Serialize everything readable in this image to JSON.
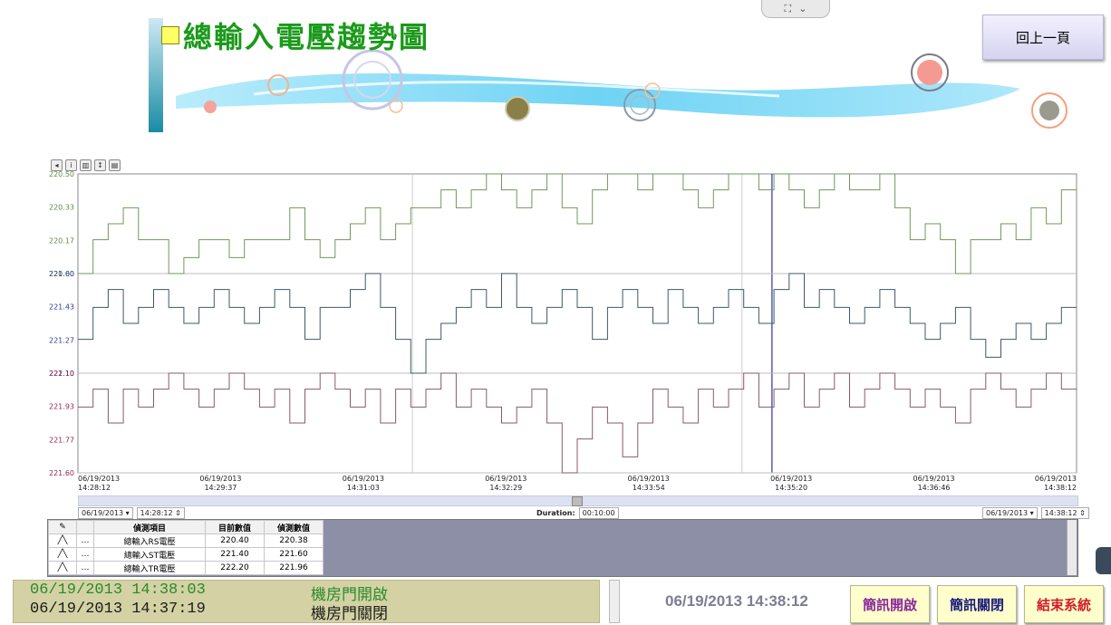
{
  "header": {
    "title": "總輸入電壓趨勢圖",
    "back_button": "回上一頁"
  },
  "chart_data": {
    "type": "line",
    "x_start": "06/19/2013 14:28:12",
    "x_end": "06/19/2013 14:38:12",
    "x_tick_labels": [
      {
        "date": "06/19/2013",
        "time": "14:28:12"
      },
      {
        "date": "06/19/2013",
        "time": "14:29:37"
      },
      {
        "date": "06/19/2013",
        "time": "14:31:03"
      },
      {
        "date": "06/19/2013",
        "time": "14:32:29"
      },
      {
        "date": "06/19/2013",
        "time": "14:33:54"
      },
      {
        "date": "06/19/2013",
        "time": "14:35:20"
      },
      {
        "date": "06/19/2013",
        "time": "14:36:46"
      },
      {
        "date": "06/19/2013",
        "time": "14:38:12"
      }
    ],
    "series": [
      {
        "color": "#6e9a5a",
        "ylim": [
          220.0,
          220.5
        ],
        "ticks": [
          "220.50",
          "220.33",
          "220.17",
          "220.00"
        ],
        "tick_color": "#5f8a45",
        "values": [
          220.0,
          220.17,
          220.25,
          220.33,
          220.17,
          220.17,
          220.0,
          220.08,
          220.17,
          220.17,
          220.08,
          220.17,
          220.17,
          220.17,
          220.33,
          220.17,
          220.08,
          220.17,
          220.25,
          220.33,
          220.17,
          220.25,
          220.33,
          220.33,
          220.42,
          220.33,
          220.42,
          220.5,
          220.42,
          220.33,
          220.42,
          220.5,
          220.33,
          220.25,
          220.42,
          220.5,
          220.5,
          220.42,
          220.5,
          220.5,
          220.42,
          220.33,
          220.42,
          220.5,
          220.5,
          220.42,
          220.5,
          220.42,
          220.33,
          220.42,
          220.5,
          220.42,
          220.42,
          220.5,
          220.33,
          220.17,
          220.25,
          220.17,
          220.0,
          220.17,
          220.17,
          220.25,
          220.17,
          220.33,
          220.25,
          220.42
        ]
      },
      {
        "color": "#3d5a66",
        "ylim": [
          221.1,
          221.6
        ],
        "ticks": [
          "221.60",
          "221.43",
          "221.27",
          "221.10"
        ],
        "tick_color": "#2d3f8c",
        "values": [
          221.27,
          221.43,
          221.52,
          221.35,
          221.43,
          221.52,
          221.43,
          221.35,
          221.43,
          221.52,
          221.43,
          221.35,
          221.43,
          221.52,
          221.43,
          221.27,
          221.43,
          221.43,
          221.52,
          221.6,
          221.43,
          221.27,
          221.1,
          221.27,
          221.35,
          221.43,
          221.52,
          221.43,
          221.6,
          221.43,
          221.35,
          221.43,
          221.52,
          221.43,
          221.27,
          221.43,
          221.52,
          221.43,
          221.35,
          221.52,
          221.43,
          221.35,
          221.43,
          221.52,
          221.43,
          221.35,
          221.52,
          221.6,
          221.43,
          221.52,
          221.43,
          221.35,
          221.43,
          221.52,
          221.43,
          221.35,
          221.27,
          221.35,
          221.43,
          221.27,
          221.18,
          221.27,
          221.35,
          221.27,
          221.35,
          221.43
        ]
      },
      {
        "color": "#8a5a66",
        "ylim": [
          221.6,
          222.1
        ],
        "ticks": [
          "222.10",
          "221.93",
          "221.77",
          "221.60"
        ],
        "tick_color": "#8a2a55",
        "values": [
          221.93,
          222.02,
          221.85,
          222.02,
          221.93,
          222.02,
          222.1,
          222.02,
          221.93,
          222.02,
          222.1,
          222.02,
          221.93,
          222.02,
          221.85,
          222.02,
          222.1,
          222.02,
          221.93,
          222.02,
          221.85,
          222.02,
          221.93,
          222.02,
          222.1,
          221.93,
          222.02,
          221.93,
          221.85,
          221.93,
          222.02,
          221.85,
          221.6,
          221.77,
          221.93,
          221.85,
          221.68,
          221.85,
          222.02,
          221.93,
          221.85,
          222.02,
          221.93,
          222.02,
          222.1,
          221.93,
          222.02,
          222.1,
          221.93,
          222.02,
          222.1,
          221.93,
          222.02,
          222.1,
          222.02,
          221.93,
          222.02,
          221.93,
          221.85,
          222.02,
          222.1,
          222.02,
          221.93,
          222.02,
          222.1,
          222.02
        ]
      }
    ]
  },
  "range": {
    "start_date": "06/19/2013",
    "start_time": "14:28:12",
    "duration_label": "Duration:",
    "duration": "00:10:00",
    "end_date": "06/19/2013",
    "end_time": "14:38:12"
  },
  "table": {
    "headers": [
      "偵測項目",
      "目前數值",
      "偵測數值"
    ],
    "rows": [
      {
        "name": "總輸入RS電壓",
        "current": "220.40",
        "detected": "220.38"
      },
      {
        "name": "總輸入ST電壓",
        "current": "221.40",
        "detected": "221.60"
      },
      {
        "name": "總輸入TR電壓",
        "current": "222.20",
        "detected": "221.96"
      }
    ]
  },
  "events": [
    {
      "time": "06/19/2013 14:38:03",
      "message": "機房門開啟",
      "color": "#2a8a2a"
    },
    {
      "time": "06/19/2013 14:37:19",
      "message": "機房門關閉",
      "color": "#1a1a1a"
    }
  ],
  "footer": {
    "clock": "06/19/2013  14:38:12",
    "msg_on": "簡訊開啟",
    "msg_off": "簡訊關閉",
    "exit": "結束系統"
  }
}
